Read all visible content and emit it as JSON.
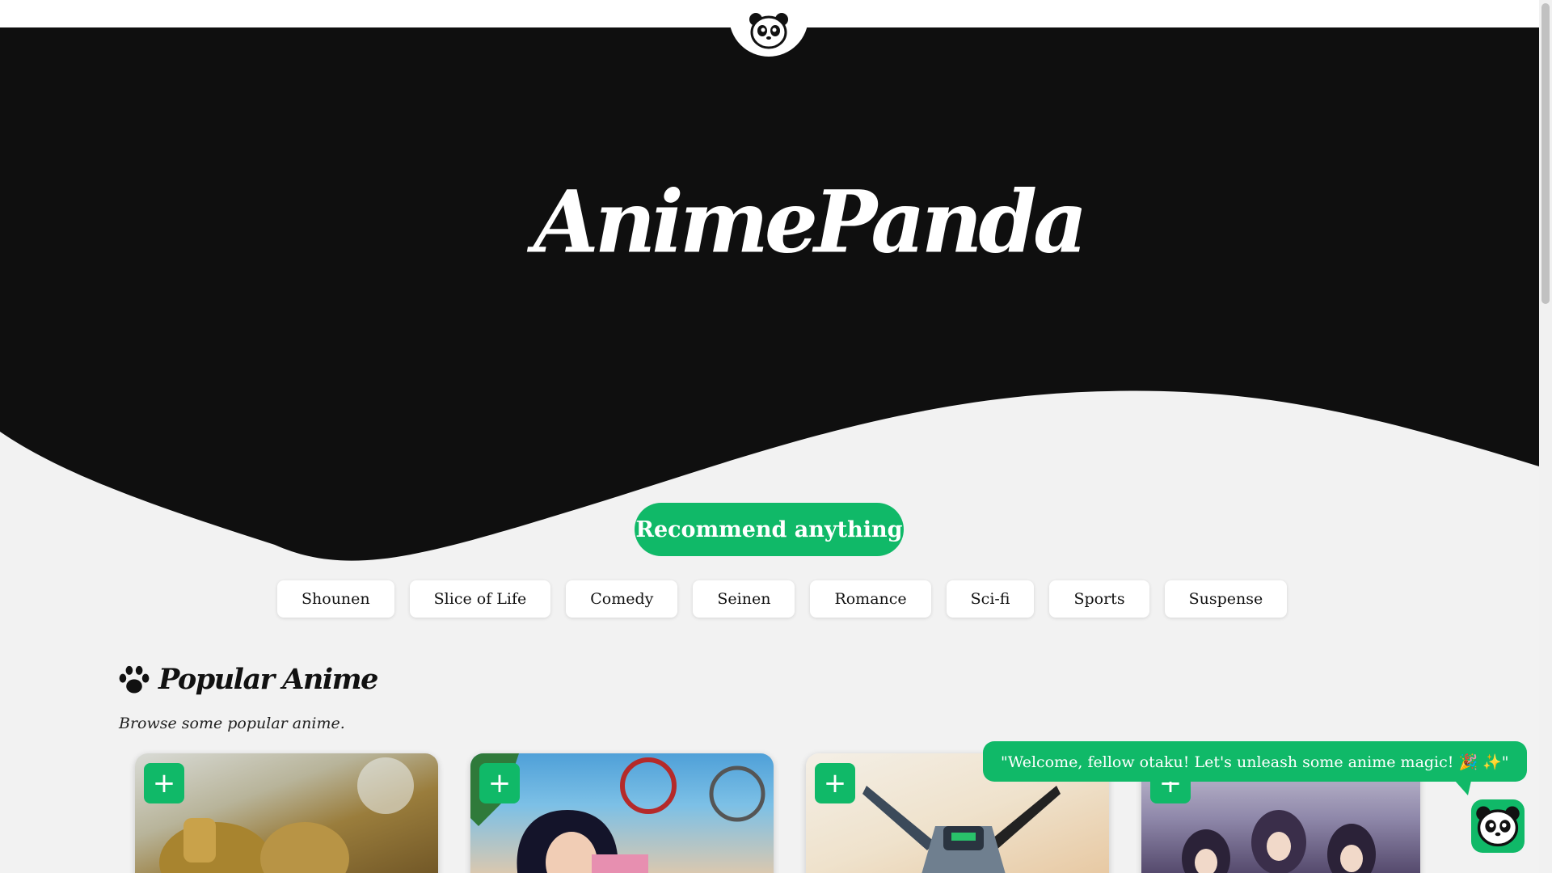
{
  "brand": {
    "name": "AnimePanda"
  },
  "colors": {
    "accent": "#10b968",
    "hero": "#0f0f0f",
    "background": "#f2f2f2"
  },
  "icons": {
    "top": "panda-icon",
    "logo_suffix": "paw-icon",
    "section": "paw-icon",
    "mascot": "panda-icon"
  },
  "cta": {
    "label": "Recommend anything"
  },
  "genres": [
    "Shounen",
    "Slice of Life",
    "Comedy",
    "Seinen",
    "Romance",
    "Sci-fi",
    "Sports",
    "Suspense"
  ],
  "popular": {
    "title": "Popular Anime",
    "subtitle": "Browse some popular anime.",
    "add_label": "+"
  },
  "chat": {
    "message": "\"Welcome, fellow otaku! Let's unleash some anime magic! 🎉 ✨\""
  }
}
